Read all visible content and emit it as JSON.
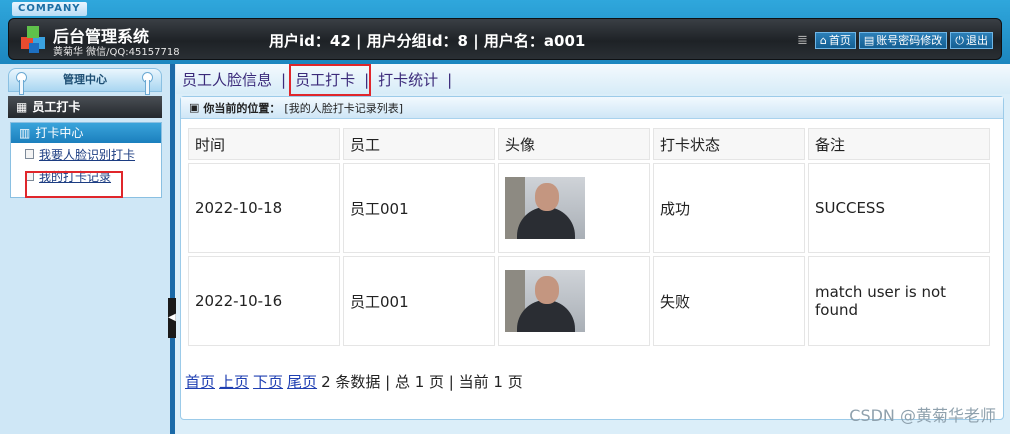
{
  "header": {
    "company": "COMPANY",
    "title": "后台管理系统",
    "subtitle": "黄菊华 微信/QQ:45157718",
    "user_info": "用户id：42 | 用户分组id：8 | 用户名：a001",
    "nav": {
      "home": "首页",
      "password": "账号密码修改",
      "logout": "退出"
    }
  },
  "sidebar": {
    "head": "管理中心",
    "section": "员工打卡",
    "menu_head": "打卡中心",
    "items": [
      {
        "label": "我要人脸识别打卡"
      },
      {
        "label": "我的打卡记录"
      }
    ]
  },
  "tabs": [
    {
      "label": "员工人脸信息"
    },
    {
      "label": "员工打卡"
    },
    {
      "label": "打卡统计"
    }
  ],
  "location": {
    "label": "你当前的位置：",
    "value": "[我的人脸打卡记录列表]"
  },
  "table": {
    "headers": [
      "时间",
      "员工",
      "头像",
      "打卡状态",
      "备注"
    ],
    "rows": [
      {
        "time": "2022-10-18",
        "employee": "员工001",
        "status": "成功",
        "remark": "SUCCESS"
      },
      {
        "time": "2022-10-16",
        "employee": "员工001",
        "status": "失败",
        "remark": "match user is not found"
      }
    ]
  },
  "pager": {
    "first": "首页",
    "prev": "上页",
    "next": "下页",
    "last": "尾页",
    "summary": "2 条数据 | 总 1 页 | 当前 1 页"
  },
  "watermark": "CSDN @黄菊华老师",
  "colors": {
    "accent": "#1b7fbd",
    "highlight": "#e0262b"
  }
}
